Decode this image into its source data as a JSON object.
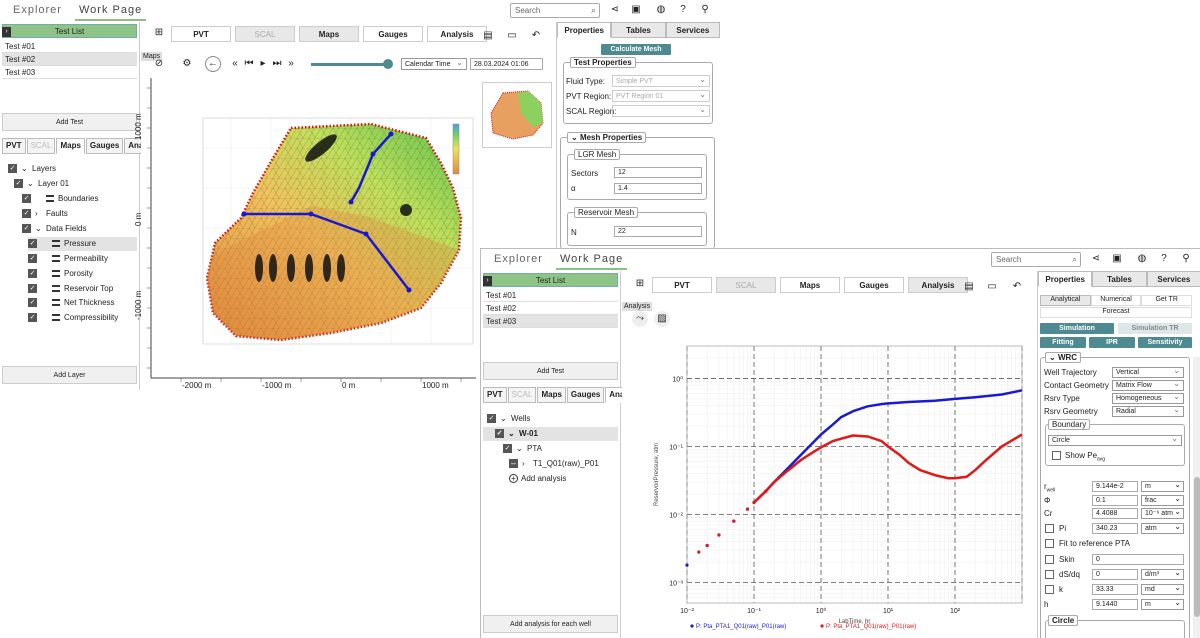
{
  "w1": {
    "nav": {
      "explorer": "Explorer",
      "work_page": "Work Page"
    },
    "search_placeholder": "Search",
    "left": {
      "list_title": "Test List",
      "tests": [
        "Test #01",
        "Test #02",
        "Test #03"
      ],
      "add_test": "Add Test",
      "subtabs": [
        "PVT",
        "SCAL",
        "Maps",
        "Gauges",
        "Analysis"
      ],
      "tree": [
        {
          "label": "Layers"
        },
        {
          "label": "Layer 01"
        },
        {
          "label": "Boundaries"
        },
        {
          "label": "Faults"
        },
        {
          "label": "Data Fields"
        },
        {
          "label": "Pressure"
        },
        {
          "label": "Permeability"
        },
        {
          "label": "Porosity"
        },
        {
          "label": "Reservoir Top"
        },
        {
          "label": "Net Thickness"
        },
        {
          "label": "Compressibility"
        }
      ],
      "add_layer": "Add Layer"
    },
    "main_tabs": [
      "PVT",
      "SCAL",
      "Maps",
      "Gauges",
      "Analysis"
    ],
    "maps_label": "Maps",
    "time_mode": "Calendar Time",
    "timestamp": "28.03.2024 01:06",
    "slider_position": 1.0,
    "axis_x": [
      "-2000 m",
      "-1000 m",
      "0 m",
      "1000 m"
    ],
    "axis_y": [
      "1000 m",
      "0 m",
      "-1000 m"
    ],
    "right": {
      "tabs": [
        "Properties",
        "Tables",
        "Services"
      ],
      "calc_mesh": "Calculate Mesh",
      "test_props": "Test Properties",
      "fluid_type_label": "Fluid Type:",
      "fluid_type": "Simple PVT",
      "pvt_region_label": "PVT Region:",
      "pvt_region": "PVT Region 01",
      "scal_region_label": "SCAL Region:",
      "scal_region": "",
      "mesh_props": "Mesh Properties",
      "lgr_mesh": "LGR Mesh",
      "sectors_label": "Sectors",
      "sectors": "12",
      "alpha_label": "α",
      "alpha": "1.4",
      "res_mesh": "Reservoir Mesh",
      "n_label": "N",
      "n": "22"
    }
  },
  "w2": {
    "nav": {
      "explorer": "Explorer",
      "work_page": "Work Page"
    },
    "search_placeholder": "Search",
    "left": {
      "list_title": "Test List",
      "tests": [
        "Test #01",
        "Test #02",
        "Test #03"
      ],
      "add_test": "Add Test",
      "subtabs": [
        "PVT",
        "SCAL",
        "Maps",
        "Gauges",
        "Analysis"
      ],
      "tree": [
        {
          "label": "Wells"
        },
        {
          "label": "W-01"
        },
        {
          "label": "PTA"
        },
        {
          "label": "T1_Q01(raw)_P01"
        },
        {
          "label": "Add analysis"
        }
      ],
      "add_each": "Add analysis for each well"
    },
    "main_tabs": [
      "PVT",
      "SCAL",
      "Maps",
      "Gauges",
      "Analysis"
    ],
    "analysis_label": "Analysis",
    "right": {
      "tabs": [
        "Properties",
        "Tables",
        "Services"
      ],
      "subtabs": [
        "Analytical",
        "Numerical",
        "Get TR"
      ],
      "forecast": "Forecast",
      "simulation": "Simulation",
      "simulation_tr": "Simulation TR",
      "fitting": "Fitting",
      "ipr": "IPR",
      "sensitivity": "Sensitivity",
      "wrc": "WRC",
      "well_traj_label": "Well Trajectory",
      "well_traj": "Vertical",
      "contact_label": "Contact Geometry",
      "contact": "Matrix Flow",
      "rsrv_type_label": "Rsrv Type",
      "rsrv_type": "Homogeneous",
      "rsrv_geom_label": "Rsrv Geometry",
      "rsrv_geom": "Radial",
      "boundary": "Boundary",
      "boundary_sel": "Circle",
      "show_pe": "Show Pe",
      "show_pe_sub": "avg",
      "rwell_label": "r",
      "rwell_sub": "well",
      "rwell": "9.144e-2",
      "rwell_unit": "m",
      "phi_label": "Φ",
      "phi": "0.1",
      "phi_unit": "frac",
      "cr_label": "Cr",
      "cr": "4.4088",
      "cr_unit": "10⁻⁶ atm",
      "pi_label": "Pi",
      "pi": "340.23",
      "pi_unit": "atm",
      "fit_ref": "Fit to reference PTA",
      "skin_label": "Skin",
      "skin": "0",
      "dsdq_label": "dS/dq",
      "dsdq": "0",
      "dsdq_unit": "d/m³",
      "k_label": "k",
      "k": "33.33",
      "k_unit": "md",
      "h_label": "h",
      "h": "9.1440",
      "h_unit": "m",
      "circle": "Circle"
    },
    "chart_data": {
      "type": "scatter",
      "xlabel": "LabTime, hr",
      "ylabel": "ReservoirPressure, atm",
      "xscale": "log",
      "yscale": "log",
      "xlim": [
        0.01,
        1000
      ],
      "ylim": [
        0.0005,
        3
      ],
      "x_ticks": [
        "10⁻²",
        "10⁻¹",
        "10⁰",
        "10¹",
        "10²"
      ],
      "y_ticks": [
        "10⁰",
        "10⁻¹",
        "10⁻²",
        "10⁻³"
      ],
      "series": [
        {
          "name": "P: Pta_PTA1_Q01(raw)_P01(raw)",
          "color": "#1a1ad6",
          "x": [
            0.01,
            0.02,
            0.03,
            0.05,
            0.08,
            0.1,
            0.15,
            0.2,
            0.3,
            0.5,
            0.8,
            1,
            1.5,
            2,
            3,
            5,
            8,
            10,
            20,
            50,
            100,
            200,
            500,
            1000
          ],
          "y": [
            0.0018,
            0.0035,
            0.005,
            0.008,
            0.012,
            0.015,
            0.022,
            0.03,
            0.045,
            0.075,
            0.12,
            0.15,
            0.21,
            0.27,
            0.33,
            0.39,
            0.42,
            0.43,
            0.45,
            0.47,
            0.5,
            0.53,
            0.58,
            0.67
          ]
        },
        {
          "name": "P: Pta_PTA1_Q01(raw)_P01(raw)",
          "color": "#e01818",
          "x": [
            0.015,
            0.02,
            0.03,
            0.05,
            0.08,
            0.1,
            0.15,
            0.2,
            0.3,
            0.5,
            0.8,
            1,
            1.5,
            2,
            3,
            5,
            8,
            10,
            15,
            20,
            30,
            50,
            80,
            100,
            150,
            200,
            300,
            500,
            1000
          ],
          "y": [
            0.0028,
            0.0035,
            0.005,
            0.008,
            0.012,
            0.015,
            0.022,
            0.03,
            0.042,
            0.063,
            0.085,
            0.097,
            0.12,
            0.13,
            0.145,
            0.14,
            0.12,
            0.1,
            0.075,
            0.058,
            0.045,
            0.038,
            0.034,
            0.034,
            0.036,
            0.045,
            0.065,
            0.1,
            0.15
          ]
        }
      ]
    }
  }
}
